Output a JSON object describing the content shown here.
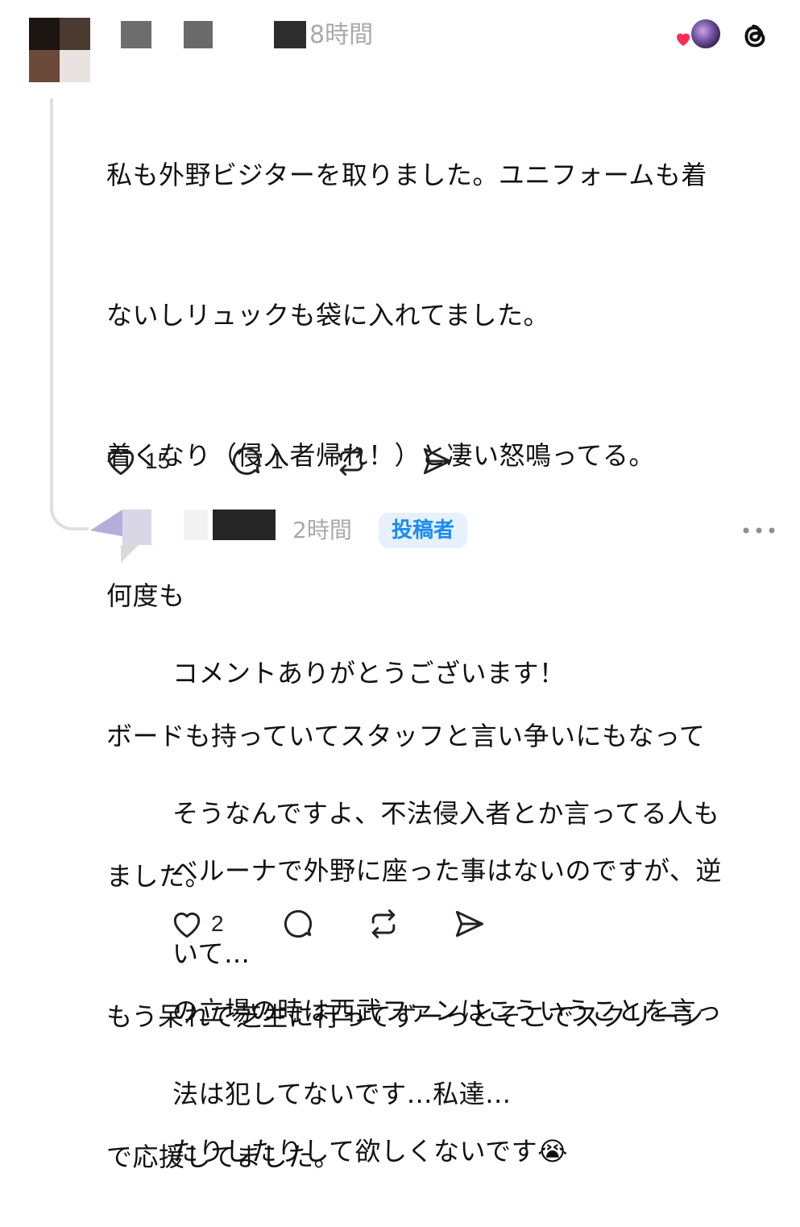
{
  "comment_1": {
    "time": "8時間",
    "text_lines": [
      "私も外野ビジターを取りました。ユニフォームも着",
      "ないしリュックも袋に入れてました。",
      "着くなり（侵入者帰れ！）と凄い怒鳴ってる。",
      "何度も",
      "ボードも持っていてスタッフと言い争いにもなって",
      "ました。",
      "もう呆れて芝生に行ってずーっとそこでスクリーン",
      "で応援してました。"
    ],
    "like_count": "15",
    "reply_count": "1",
    "icons": {
      "like": "heart-outline-icon",
      "reply": "comment-bubble-icon",
      "repost": "repost-icon",
      "share": "send-icon",
      "liked_by": "heart-filled-icon",
      "app": "threads-logo-icon"
    }
  },
  "comment_2": {
    "time": "2時間",
    "badge": "投稿者",
    "paragraph_1": [
      "コメントありがとうございます！",
      "そうなんですよ、不法侵入者とか言ってる人も",
      "いて…",
      "法は犯してないです…私達…"
    ],
    "paragraph_2": [
      "ベルーナで外野に座った事はないのですが、逆",
      "の立場の時は西武ファンはこういうことを言っ",
      "たりしたりして欲しくないです😭"
    ],
    "like_count": "2"
  },
  "colors": {
    "accent_blue": "#1a8cf0",
    "badge_bg": "#e6f1fd",
    "liked_heart": "#ff2d55",
    "muted_text": "#a9a9a9",
    "thread_line": "#e0e0e0"
  }
}
